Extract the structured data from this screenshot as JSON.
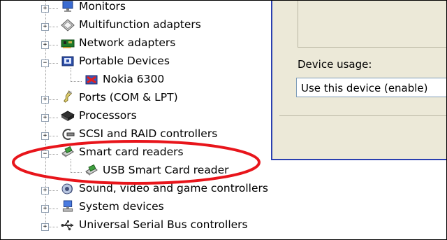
{
  "tree": {
    "items": [
      {
        "label": "Monitors",
        "expander": "+",
        "icon": "monitor-icon"
      },
      {
        "label": "Multifunction adapters",
        "expander": "+",
        "icon": "multifunction-icon"
      },
      {
        "label": "Network adapters",
        "expander": "+",
        "icon": "network-card-icon"
      },
      {
        "label": "Portable Devices",
        "expander": "−",
        "icon": "portable-device-icon"
      },
      {
        "label": "Nokia 6300",
        "expander": "",
        "icon": "phone-icon"
      },
      {
        "label": "Ports (COM & LPT)",
        "expander": "+",
        "icon": "port-icon"
      },
      {
        "label": "Processors",
        "expander": "+",
        "icon": "processor-icon"
      },
      {
        "label": "SCSI and RAID controllers",
        "expander": "+",
        "icon": "scsi-icon"
      },
      {
        "label": "Smart card readers",
        "expander": "−",
        "icon": "smart-card-reader-icon"
      },
      {
        "label": "USB Smart Card reader",
        "expander": "",
        "icon": "smart-card-reader-icon"
      },
      {
        "label": "Sound, video and game controllers",
        "expander": "+",
        "icon": "sound-icon"
      },
      {
        "label": "System devices",
        "expander": "+",
        "icon": "system-icon"
      },
      {
        "label": "Universal Serial Bus controllers",
        "expander": "+",
        "icon": "usb-icon"
      }
    ]
  },
  "panel": {
    "device_usage_label": "Device usage:",
    "device_usage_value": "Use this device (enable)"
  },
  "colors": {
    "highlight_ring": "#e8151b",
    "panel_bg": "#ece9d8",
    "panel_border": "#2a3fb0"
  }
}
